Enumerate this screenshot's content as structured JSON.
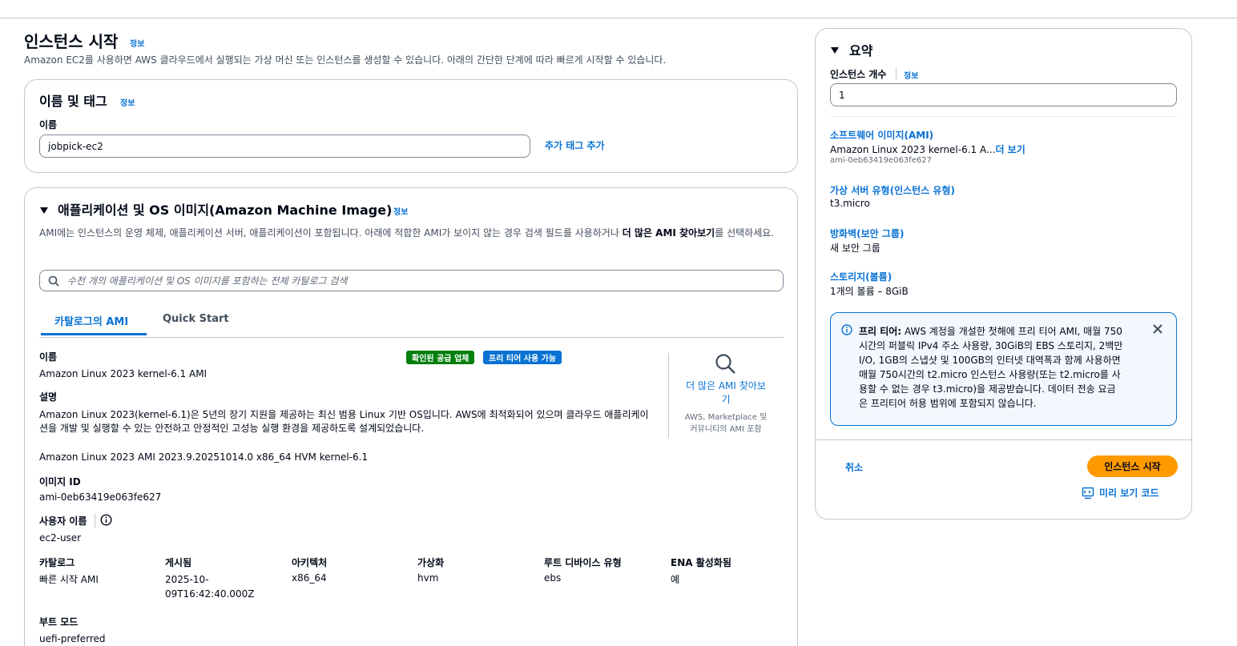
{
  "page": {
    "title": "인스턴스 시작",
    "info": "정보",
    "description": "Amazon EC2를 사용하면 AWS 클라우드에서 실행되는 가상 머신 또는 인스턴스를 생성할 수 있습니다. 아래의 간단한 단계에 따라 빠르게 시작할 수 있습니다."
  },
  "name_tags": {
    "title": "이름 및 태그",
    "info": "정보",
    "name_label": "이름",
    "name_value": "jobpick-ec2",
    "add_tags": "추가 태그 추가"
  },
  "ami": {
    "title": "애플리케이션 및 OS 이미지(Amazon Machine Image)",
    "info": "정보",
    "description_pre": "AMI에는 인스턴스의 운영 체제, 애플리케이션 서버, 애플리케이션이 포함됩니다. 아래에 적합한 AMI가 보이지 않는 경우 검색 필드를 사용하거나 ",
    "description_bold": "더 많은 AMI 찾아보기",
    "description_post": "를 선택하세요.",
    "search_placeholder": "수천 개의 애플리케이션 및 OS 이미지를 포함하는 전체 카탈로그 검색",
    "tabs": [
      "카탈로그의 AMI",
      "Quick Start"
    ],
    "name_label": "이름",
    "name_value": "Amazon Linux 2023 kernel-6.1 AMI",
    "badge_verified": "확인된 공급 업체",
    "badge_free": "프리 티어 사용 가능",
    "desc_label": "설명",
    "desc_value_line1": "Amazon Linux 2023(kernel-6.1)은 5년의 장기 지원을 제공하는 최신 범용 Linux 기반 OS입니다. AWS에 최적화되어 있으며 클라우드 애플리케이",
    "desc_value_line2": "션을 개발 및 실행할 수 있는 안전하고 안정적인 고성능 실행 환경을 제공하도록 설계되었습니다.",
    "browse_more_line1": "더 많은 AMI 찾아보",
    "browse_more_line2": "기",
    "browse_more_sub_line1": "AWS, Marketplace 및",
    "browse_more_sub_line2": "커뮤니티의 AMI 포함",
    "full_name": "Amazon Linux 2023 AMI 2023.9.20251014.0 x86_64 HVM kernel-6.1",
    "image_id_label": "이미지 ID",
    "image_id_value": "ami-0eb63419e063fe627",
    "username_label": "사용자 이름",
    "username_value": "ec2-user",
    "columns": [
      {
        "label": "카탈로그",
        "value": "빠른 시작 AMI",
        "value2": ""
      },
      {
        "label": "게시됨",
        "value": "2025-10-",
        "value2": "09T16:42:40.000Z"
      },
      {
        "label": "아키텍처",
        "value": "x86_64",
        "value2": ""
      },
      {
        "label": "가상화",
        "value": "hvm",
        "value2": ""
      },
      {
        "label": "루트 디바이스 유형",
        "value": "ebs",
        "value2": ""
      },
      {
        "label": "ENA 활성화됨",
        "value": "예",
        "value2": ""
      }
    ],
    "boot_mode_label": "부트 모드",
    "boot_mode_value": "uefi-preferred"
  },
  "summary": {
    "title": "요약",
    "count_label": "인스턴스 개수",
    "info": "정보",
    "count_value": "1",
    "software_label": "소프트웨어 이미지(AMI)",
    "software_value": "Amazon Linux 2023 kernel-6.1 A...",
    "software_more": "더 보기",
    "software_id": "ami-0eb63419e063fe627",
    "type_label": "가상 서버 유형(인스턴스 유형)",
    "type_value": "t3.micro",
    "firewall_label": "방화벽(보안 그룹)",
    "firewall_value": "새 보안 그룹",
    "storage_label": "스토리지(볼륨)",
    "storage_value": "1개의 볼륨 – 8GiB",
    "free_tier_bold": "프리 티어:",
    "free_tier_lines": [
      " AWS 계정을 개설한 첫해에 프리 티어 AMI, 매월 750",
      "시간의 퍼블릭 IPv4 주소 사용량, 30GiB의 EBS 스토리지, 2백만",
      "I/O, 1GB의 스냅샷 및 100GB의 인터넷 대역폭과 함께 사용하면",
      "매월 750시간의 t2.micro 인스턴스 사용량(또는 t2.micro를 사",
      "용할 수 없는 경우 t3.micro)을 제공받습니다. 데이터 전송 요금",
      "은 프리티어 허용 범위에 포함되지 않습니다."
    ],
    "cancel": "취소",
    "launch": "인스턴스 시작",
    "preview_code": "미리 보기 코드"
  },
  "colors": {
    "link": "#0972d3",
    "primary_button": "#ff9900",
    "badge_green": "#037f0c",
    "badge_blue": "#0972d3",
    "info_box_bg": "#f2f8fd"
  }
}
